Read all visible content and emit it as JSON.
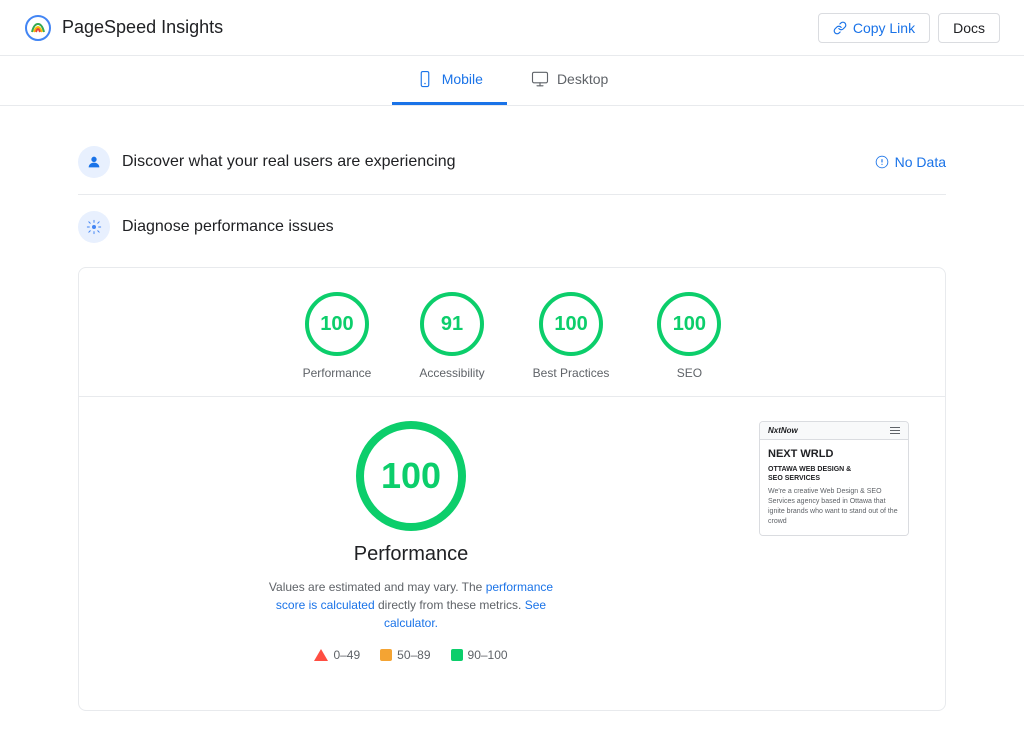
{
  "header": {
    "title": "PageSpeed Insights",
    "copy_link_label": "Copy Link",
    "docs_label": "Docs"
  },
  "tabs": [
    {
      "id": "mobile",
      "label": "Mobile",
      "active": true
    },
    {
      "id": "desktop",
      "label": "Desktop",
      "active": false
    }
  ],
  "real_users_section": {
    "title": "Discover what your real users are experiencing",
    "no_data_label": "No Data"
  },
  "diagnose_section": {
    "title": "Diagnose performance issues"
  },
  "scores": [
    {
      "id": "performance",
      "value": "100",
      "label": "Performance"
    },
    {
      "id": "accessibility",
      "value": "91",
      "label": "Accessibility"
    },
    {
      "id": "best-practices",
      "value": "100",
      "label": "Best Practices"
    },
    {
      "id": "seo",
      "value": "100",
      "label": "SEO"
    }
  ],
  "detail": {
    "score": "100",
    "title": "Performance",
    "desc_prefix": "Values are estimated and may vary. The",
    "desc_link1_label": "performance score is calculated",
    "desc_link1_href": "#",
    "desc_middle": "directly from these metrics.",
    "desc_link2_label": "See calculator.",
    "desc_link2_href": "#"
  },
  "legend": [
    {
      "id": "fail",
      "color": "triangle",
      "range": "0–49"
    },
    {
      "id": "average",
      "color": "#f4a433",
      "range": "50–89"
    },
    {
      "id": "pass",
      "color": "#0cce6b",
      "range": "90–100"
    }
  ],
  "thumbnail": {
    "logo": "NxtNow",
    "headline": "NEXT WRLD",
    "subline1": "OTTAWA WEB DESIGN &",
    "subline2": "SEO SERVICES",
    "body_text": "We're a creative Web Design & SEO Services agency based in Ottawa that ignite brands who want to stand out of the crowd"
  },
  "icons": {
    "link": "🔗",
    "info": "ℹ",
    "mobile": "📱",
    "desktop": "🖥",
    "user": "👤",
    "gear": "⚙"
  },
  "colors": {
    "green": "#0cce6b",
    "orange": "#f4a433",
    "red": "#ff4e42",
    "blue": "#1a73e8",
    "border": "#e8eaed"
  }
}
